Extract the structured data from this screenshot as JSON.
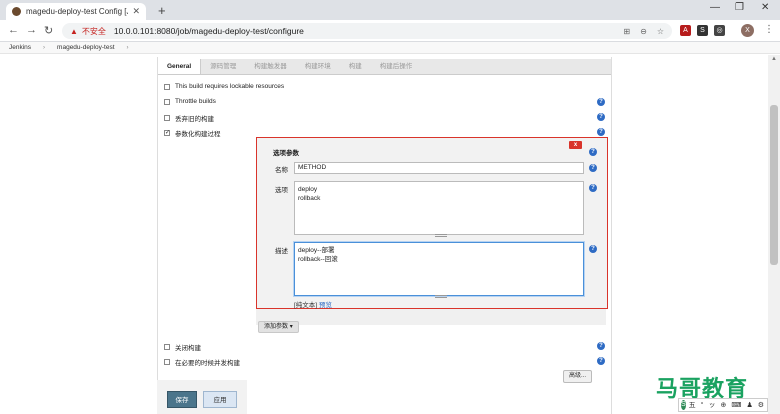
{
  "browser": {
    "tab_title": "magedu-deploy-test Config [Je",
    "url": "10.0.0.101:8080/job/magedu-deploy-test/configure",
    "insecure_label": "不安全",
    "profile_initial": "X"
  },
  "breadcrumb": [
    "Jenkins",
    "magedu-deploy-test"
  ],
  "tabs": [
    {
      "label": "General"
    },
    {
      "label": "源码管理"
    },
    {
      "label": "构建触发器"
    },
    {
      "label": "构建环境"
    },
    {
      "label": "构建"
    },
    {
      "label": "构建后操作"
    }
  ],
  "options": {
    "lockable": "This build requires lockable resources",
    "throttle": "Throttle builds",
    "discard": "丢弃旧的构建",
    "parameterized": "参数化构建过程",
    "disable": "关闭构建",
    "concurrent": "在必要的时候并发构建"
  },
  "param": {
    "title": "选项参数",
    "delete_label": "x",
    "name_label": "名称",
    "name_value": "METHOD",
    "choices_label": "选项",
    "choices_value": "deploy\nrollback",
    "desc_label": "描述",
    "desc_value": "deploy--部署\nrollback--回滚",
    "plain_text": "[纯文本]",
    "preview": "预览"
  },
  "buttons": {
    "add_param": "添加参数",
    "advanced": "高级...",
    "save": "保存",
    "apply": "应用"
  },
  "watermark": "马哥教育",
  "ime": [
    "五",
    "°",
    "ッ",
    "⊕",
    "⌨",
    "♟",
    "⚙"
  ]
}
